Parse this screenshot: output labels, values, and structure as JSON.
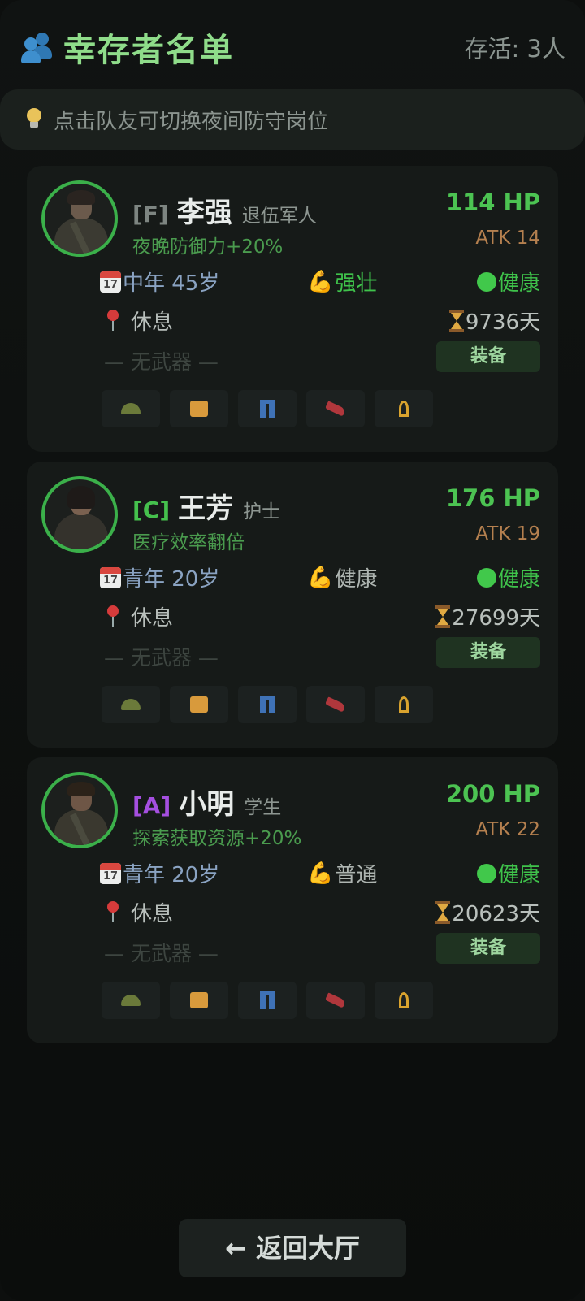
{
  "header": {
    "title": "幸存者名单",
    "alive_text": "存活: 3人"
  },
  "tip": {
    "text": "点击队友可切换夜间防守岗位"
  },
  "survivors": [
    {
      "rank": "[F]",
      "rank_color": "#7d8581",
      "name": "李强",
      "job": "退伍军人",
      "perk": "夜晚防御力+20%",
      "hp": "114 HP",
      "atk": "ATK 14",
      "age": "中年 45岁",
      "physique": "强壮",
      "physique_color": "#3fc34b",
      "health": "健康",
      "location": "休息",
      "days": "9736天",
      "weapon": "— 无武器 —",
      "equip_label": "装备"
    },
    {
      "rank": "[C]",
      "rank_color": "#45c14d",
      "name": "王芳",
      "job": "护士",
      "perk": "医疗效率翻倍",
      "hp": "176 HP",
      "atk": "ATK 19",
      "age": "青年 20岁",
      "physique": "健康",
      "physique_color": "#aeb5b1",
      "health": "健康",
      "location": "休息",
      "days": "27699天",
      "weapon": "— 无武器 —",
      "equip_label": "装备"
    },
    {
      "rank": "[A]",
      "rank_color": "#a54fe0",
      "name": "小明",
      "job": "学生",
      "perk": "探索获取资源+20%",
      "hp": "200 HP",
      "atk": "ATK 22",
      "age": "青年 20岁",
      "physique": "普通",
      "physique_color": "#aeb5b1",
      "health": "健康",
      "location": "休息",
      "days": "20623天",
      "weapon": "— 无武器 —",
      "equip_label": "装备"
    }
  ],
  "calendar_icon_number": "17",
  "back_button": "← 返回大厅"
}
